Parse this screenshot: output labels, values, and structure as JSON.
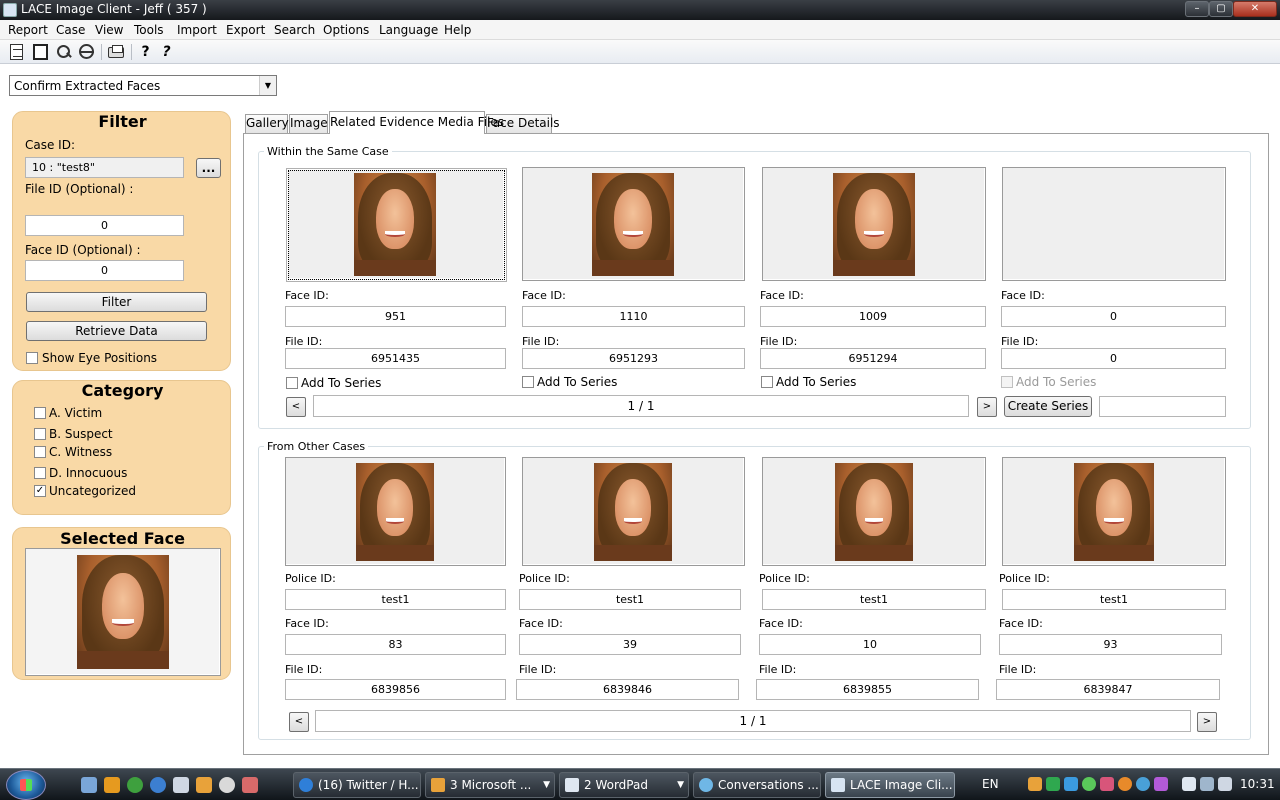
{
  "window": {
    "title": "LACE Image Client - Jeff ( 357 )",
    "minimize": "–",
    "maximize": "▢",
    "close": "✕"
  },
  "menu": [
    "Report",
    "Case",
    "View",
    "Tools",
    "Import",
    "Export",
    "Search",
    "Options",
    "Language",
    "Help"
  ],
  "toolbar": {
    "icons": [
      "new-report-icon",
      "display-icon",
      "search-icon",
      "globe-icon",
      "print-icon",
      "help-icon",
      "context-help-icon"
    ],
    "help_glyph": "?",
    "context_help_glyph": "?"
  },
  "mode_dropdown": {
    "value": "Confirm Extracted Faces",
    "arrow": "▼"
  },
  "filter": {
    "heading": "Filter",
    "case_id_label": "Case ID:",
    "case_id_value": "10 : \"test8\"",
    "browse_label": "...",
    "file_id_label": "File ID (Optional) :",
    "file_id_value": "0",
    "face_id_label": "Face ID (Optional) :",
    "face_id_value": "0",
    "filter_button": "Filter",
    "retrieve_button": "Retrieve Data",
    "show_eye_positions": "Show Eye Positions"
  },
  "category": {
    "heading": "Category",
    "items": [
      {
        "label": "A. Victim",
        "checked": false
      },
      {
        "label": "B. Suspect",
        "checked": false
      },
      {
        "label": "C. Witness",
        "checked": false
      },
      {
        "label": "D. Innocuous",
        "checked": false
      },
      {
        "label": "Uncategorized",
        "checked": true
      }
    ],
    "check_mark": "✓"
  },
  "selected_face": {
    "heading": "Selected Face"
  },
  "tabs": [
    {
      "label": "Gallery",
      "active": false
    },
    {
      "label": "Image",
      "active": false
    },
    {
      "label": "Related Evidence Media Files",
      "active": true
    },
    {
      "label": "Face Details",
      "active": false
    }
  ],
  "same_case": {
    "title": "Within the Same Case",
    "face_id_label": "Face ID:",
    "file_id_label": "File ID:",
    "add_to_series_label": "Add To Series",
    "cards": [
      {
        "face_id": "951",
        "file_id": "6951435",
        "has_image": true
      },
      {
        "face_id": "1110",
        "file_id": "6951293",
        "has_image": true
      },
      {
        "face_id": "1009",
        "file_id": "6951294",
        "has_image": true
      },
      {
        "face_id": "0",
        "file_id": "0",
        "has_image": false
      }
    ],
    "pager": "1 / 1",
    "prev": "<",
    "next": ">",
    "create_series_button": "Create Series",
    "series_name_value": ""
  },
  "other_cases": {
    "title": "From Other Cases",
    "police_id_label": "Police ID:",
    "face_id_label": "Face ID:",
    "file_id_label": "File ID:",
    "cards": [
      {
        "police_id": "test1",
        "face_id": "83",
        "file_id": "6839856"
      },
      {
        "police_id": "test1",
        "face_id": "39",
        "file_id": "6839846"
      },
      {
        "police_id": "test1",
        "face_id": "10",
        "file_id": "6839855"
      },
      {
        "police_id": "test1",
        "face_id": "93",
        "file_id": "6839847"
      }
    ],
    "pager": "1 / 1",
    "prev": "<",
    "next": ">"
  },
  "taskbar": {
    "tasks": [
      {
        "label": "(16) Twitter / H...",
        "active": false,
        "icon_color": "#2f7fd8"
      },
      {
        "label": "3 Microsoft ...",
        "active": false,
        "icon_color": "#e8a23a",
        "dropdown": "▼"
      },
      {
        "label": "2 WordPad",
        "active": false,
        "icon_color": "#dfe7f1",
        "dropdown": "▼"
      },
      {
        "label": "Conversations ...",
        "active": false,
        "icon_color": "#6fb7e6"
      },
      {
        "label": "LACE Image Cli...",
        "active": true,
        "icon_color": "#d7e4f2"
      }
    ],
    "language": "EN",
    "clock": "10:31"
  }
}
